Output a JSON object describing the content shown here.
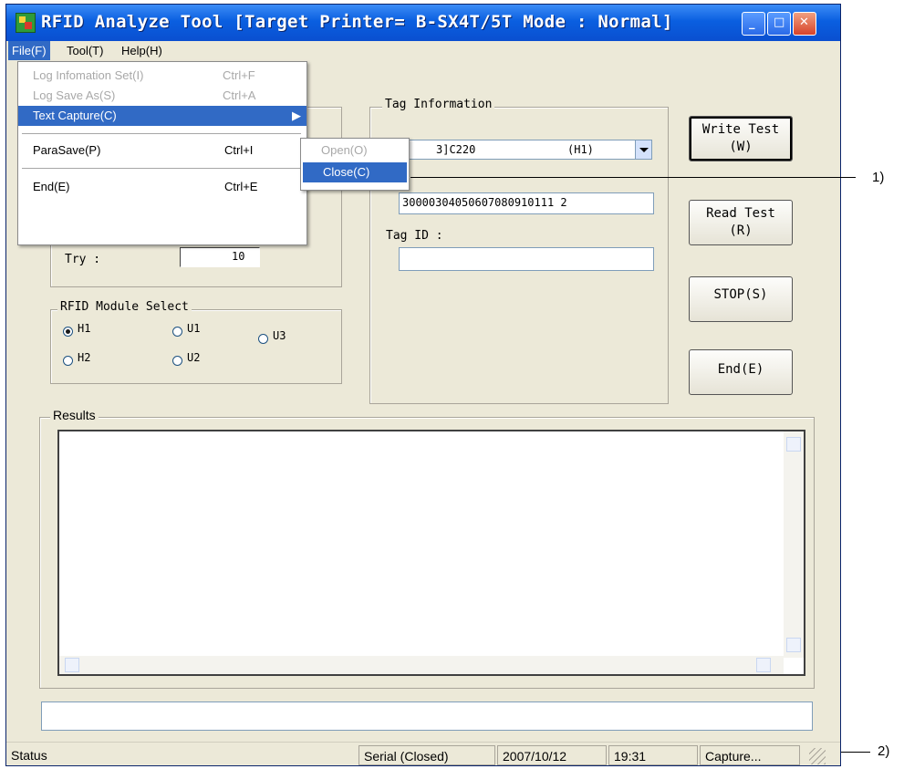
{
  "window": {
    "title": "RFID Analyze Tool [Target Printer= B-SX4T/5T Mode : Normal]",
    "controls": {
      "minimize": "_",
      "maximize": "□",
      "close": "✕"
    }
  },
  "menubar": {
    "items": [
      "File(F)",
      "Tool(T)",
      "Help(H)"
    ]
  },
  "file_menu": {
    "items": [
      {
        "label": "Log Infomation Set(I)",
        "shortcut": "Ctrl+F",
        "enabled": false
      },
      {
        "label": "Log Save As(S)",
        "shortcut": "Ctrl+A",
        "enabled": false
      },
      {
        "label": "Text Capture(C)",
        "shortcut": "",
        "enabled": true,
        "highlighted": true,
        "submenu": true
      },
      {
        "label": "ParaSave(P)",
        "shortcut": "Ctrl+I",
        "enabled": true
      },
      {
        "label": "End(E)",
        "shortcut": "Ctrl+E",
        "enabled": true
      }
    ]
  },
  "capture_submenu": {
    "items": [
      {
        "label": "Open(O)",
        "enabled": false
      },
      {
        "label": "Close(C)",
        "enabled": true,
        "highlighted": true
      }
    ]
  },
  "settings": {
    "try_label": "Try :",
    "try_value": "10"
  },
  "module_select": {
    "title": "RFID Module Select",
    "options": [
      {
        "label": "H1",
        "checked": true
      },
      {
        "label": "U1",
        "checked": false
      },
      {
        "label": "U3",
        "checked": false
      },
      {
        "label": "H2",
        "checked": false
      },
      {
        "label": "U2",
        "checked": false
      }
    ]
  },
  "tag_info": {
    "title": "Tag Information",
    "combo_value_partial": "3]C220",
    "combo_module": "(H1)",
    "hidden_label_partial": ".",
    "data_value": "30000304050607080910111 2",
    "tag_id_label": "Tag ID :",
    "tag_id_value": ""
  },
  "buttons": {
    "write_test": [
      "Write Test",
      "(W)"
    ],
    "read_test": [
      "Read Test",
      "(R)"
    ],
    "stop": "STOP(S)",
    "end": "End(E)"
  },
  "results": {
    "title": "Results",
    "content": ""
  },
  "bottom_field": "",
  "statusbar": {
    "status": "Status",
    "serial": "Serial (Closed)",
    "date": "2007/10/12",
    "time": "19:31",
    "capture": "Capture..."
  },
  "callouts": [
    "1)",
    "2)"
  ]
}
